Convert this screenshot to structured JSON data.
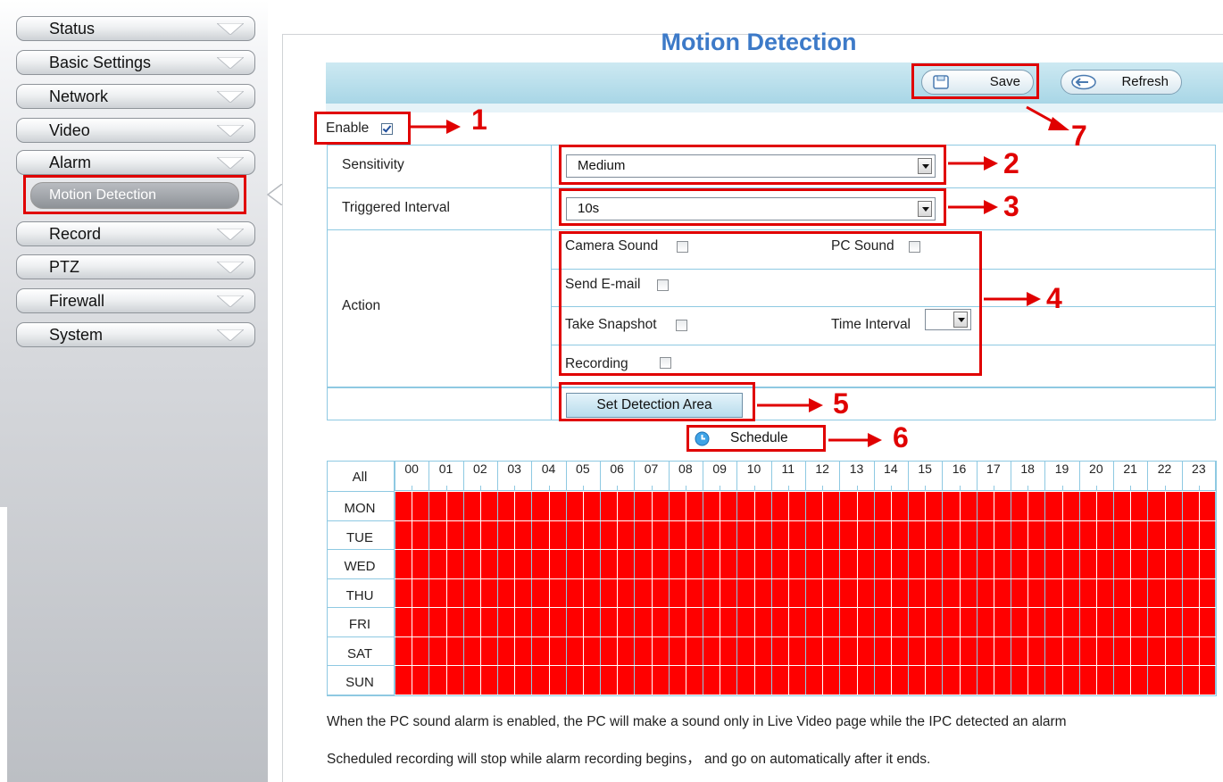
{
  "sidebar": {
    "items": [
      {
        "label": "Status"
      },
      {
        "label": "Basic Settings"
      },
      {
        "label": "Network"
      },
      {
        "label": "Video"
      },
      {
        "label": "Alarm"
      },
      {
        "label": "Record"
      },
      {
        "label": "PTZ"
      },
      {
        "label": "Firewall"
      },
      {
        "label": "System"
      }
    ],
    "active_sub_item": "Motion Detection"
  },
  "page": {
    "title": "Motion Detection"
  },
  "toolbar": {
    "save_label": "Save",
    "refresh_label": "Refresh"
  },
  "form": {
    "enable_label": "Enable",
    "enable_checked": true,
    "sensitivity_label": "Sensitivity",
    "sensitivity_value": "Medium",
    "interval_label": "Triggered Interval",
    "interval_value": "10s",
    "action_label": "Action",
    "camera_sound_label": "Camera Sound",
    "pc_sound_label": "PC Sound",
    "send_email_label": "Send E-mail",
    "take_snapshot_label": "Take Snapshot",
    "time_interval_label": "Time Interval",
    "time_interval_value": "",
    "recording_label": "Recording",
    "set_area_label": "Set Detection Area"
  },
  "schedule": {
    "label": "Schedule",
    "all_label": "All",
    "days": [
      "MON",
      "TUE",
      "WED",
      "THU",
      "FRI",
      "SAT",
      "SUN"
    ],
    "hours": [
      "00",
      "01",
      "02",
      "03",
      "04",
      "05",
      "06",
      "07",
      "08",
      "09",
      "10",
      "11",
      "12",
      "13",
      "14",
      "15",
      "16",
      "17",
      "18",
      "19",
      "20",
      "21",
      "22",
      "23"
    ],
    "selected": "all"
  },
  "annotations": [
    "1",
    "2",
    "3",
    "4",
    "5",
    "6",
    "7"
  ],
  "notes": [
    "When the PC sound alarm is enabled, the PC will make a sound only in Live Video page while the IPC detected an alarm",
    "Scheduled recording will stop while alarm recording begins， and go on automatically after it ends."
  ],
  "colors": {
    "accent": "#3d7ac8",
    "highlight": "#e00000",
    "schedule_fill": "#ff0000",
    "grid": "#8ec9e2"
  }
}
